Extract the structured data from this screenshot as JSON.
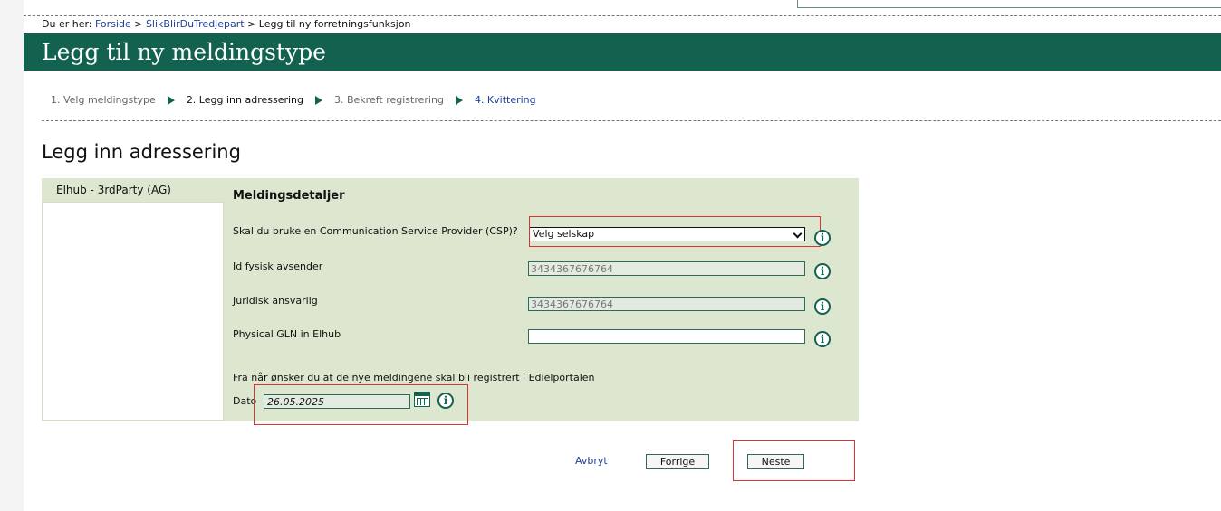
{
  "breadcrumb": {
    "prefix": "Du er her:",
    "home": "Forside",
    "sep1": ">",
    "section": "SlikBlirDuTredjepart",
    "sep2": ">",
    "current": "Legg til ny forretningsfunksjon"
  },
  "banner": {
    "title": "Legg til ny meldingstype"
  },
  "steps": [
    {
      "label": "1. Velg meldingstype",
      "state": "done"
    },
    {
      "label": "2. Legg inn adressering",
      "state": "current"
    },
    {
      "label": "3. Bekreft registrering",
      "state": "pending"
    },
    {
      "label": "4. Kvittering",
      "state": "next"
    }
  ],
  "page_title": "Legg inn adressering",
  "sidebar": {
    "selected_item": "Elhub - 3rdParty (AG)"
  },
  "details": {
    "section_title": "Meldingsdetaljer",
    "csp": {
      "label": "Skal du bruke en Communication Service Provider (CSP)?",
      "selected": "Velg selskap"
    },
    "id_sender": {
      "label": "Id fysisk avsender",
      "value": "3434367676764"
    },
    "legal": {
      "label": "Juridisk ansvarlig",
      "value": "3434367676764"
    },
    "gln": {
      "label": "Physical GLN in Elhub",
      "value": ""
    },
    "date_question": "Fra når ønsker du at de nye meldingene skal bli registrert i Edielportalen",
    "date": {
      "label": "Dato",
      "value": "26.05.2025"
    }
  },
  "actions": {
    "cancel": "Avbryt",
    "previous": "Forrige",
    "next": "Neste"
  },
  "icons": {
    "info": "info-icon",
    "calendar": "calendar-icon",
    "step_arrow": "arrow-right-icon"
  },
  "colors": {
    "brand": "#13614f",
    "panel": "#dde6cf",
    "link": "#1f3f99",
    "highlight": "#e03030"
  }
}
